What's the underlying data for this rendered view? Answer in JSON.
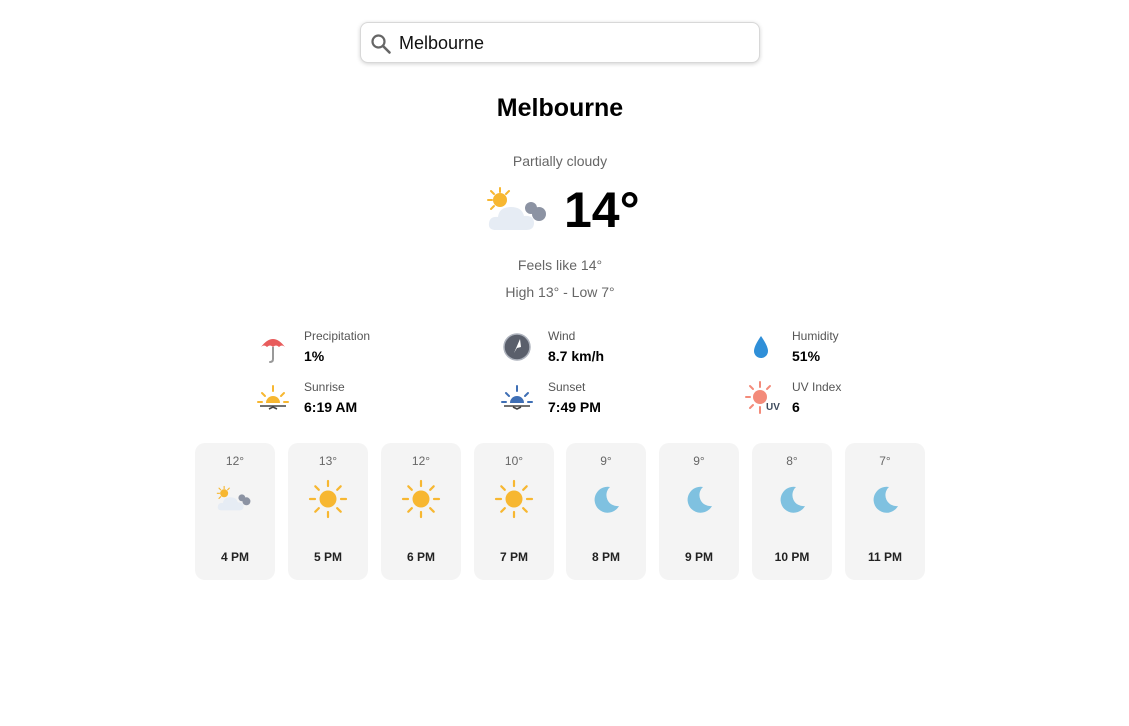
{
  "search": {
    "value": "Melbourne",
    "icon": "search-icon"
  },
  "current": {
    "city": "Melbourne",
    "condition": "Partially cloudy",
    "temperature": "14°",
    "icon": "partly-cloudy-icon",
    "feels_like": "Feels like 14°",
    "high_low": "High 13° - Low 7°"
  },
  "details": {
    "precipitation": {
      "label": "Precipitation",
      "value": "1%",
      "icon": "umbrella-icon"
    },
    "wind": {
      "label": "Wind",
      "value": "8.7 km/h",
      "icon": "compass-icon"
    },
    "humidity": {
      "label": "Humidity",
      "value": "51%",
      "icon": "raindrop-icon"
    },
    "sunrise": {
      "label": "Sunrise",
      "value": "6:19 AM",
      "icon": "sunrise-icon"
    },
    "sunset": {
      "label": "Sunset",
      "value": "7:49 PM",
      "icon": "sunset-icon"
    },
    "uv": {
      "label": "UV Index",
      "value": "6",
      "icon": "uv-index-icon"
    }
  },
  "hourly": [
    {
      "temp": "12°",
      "time": "4 PM",
      "icon": "partly-cloudy-icon"
    },
    {
      "temp": "13°",
      "time": "5 PM",
      "icon": "sun-icon"
    },
    {
      "temp": "12°",
      "time": "6 PM",
      "icon": "sun-icon"
    },
    {
      "temp": "10°",
      "time": "7 PM",
      "icon": "sun-icon"
    },
    {
      "temp": "9°",
      "time": "8 PM",
      "icon": "moon-icon"
    },
    {
      "temp": "9°",
      "time": "9 PM",
      "icon": "moon-icon"
    },
    {
      "temp": "8°",
      "time": "10 PM",
      "icon": "moon-icon"
    },
    {
      "temp": "7°",
      "time": "11 PM",
      "icon": "moon-icon"
    }
  ],
  "colors": {
    "sun": "#f7b731",
    "moon": "#7fc1e0",
    "cloud": "#dfe6ef",
    "umbrella": "#e85c5c",
    "water": "#2f8fd8",
    "sunset_blue": "#3f6fb5",
    "uv": "#f38b7a"
  }
}
